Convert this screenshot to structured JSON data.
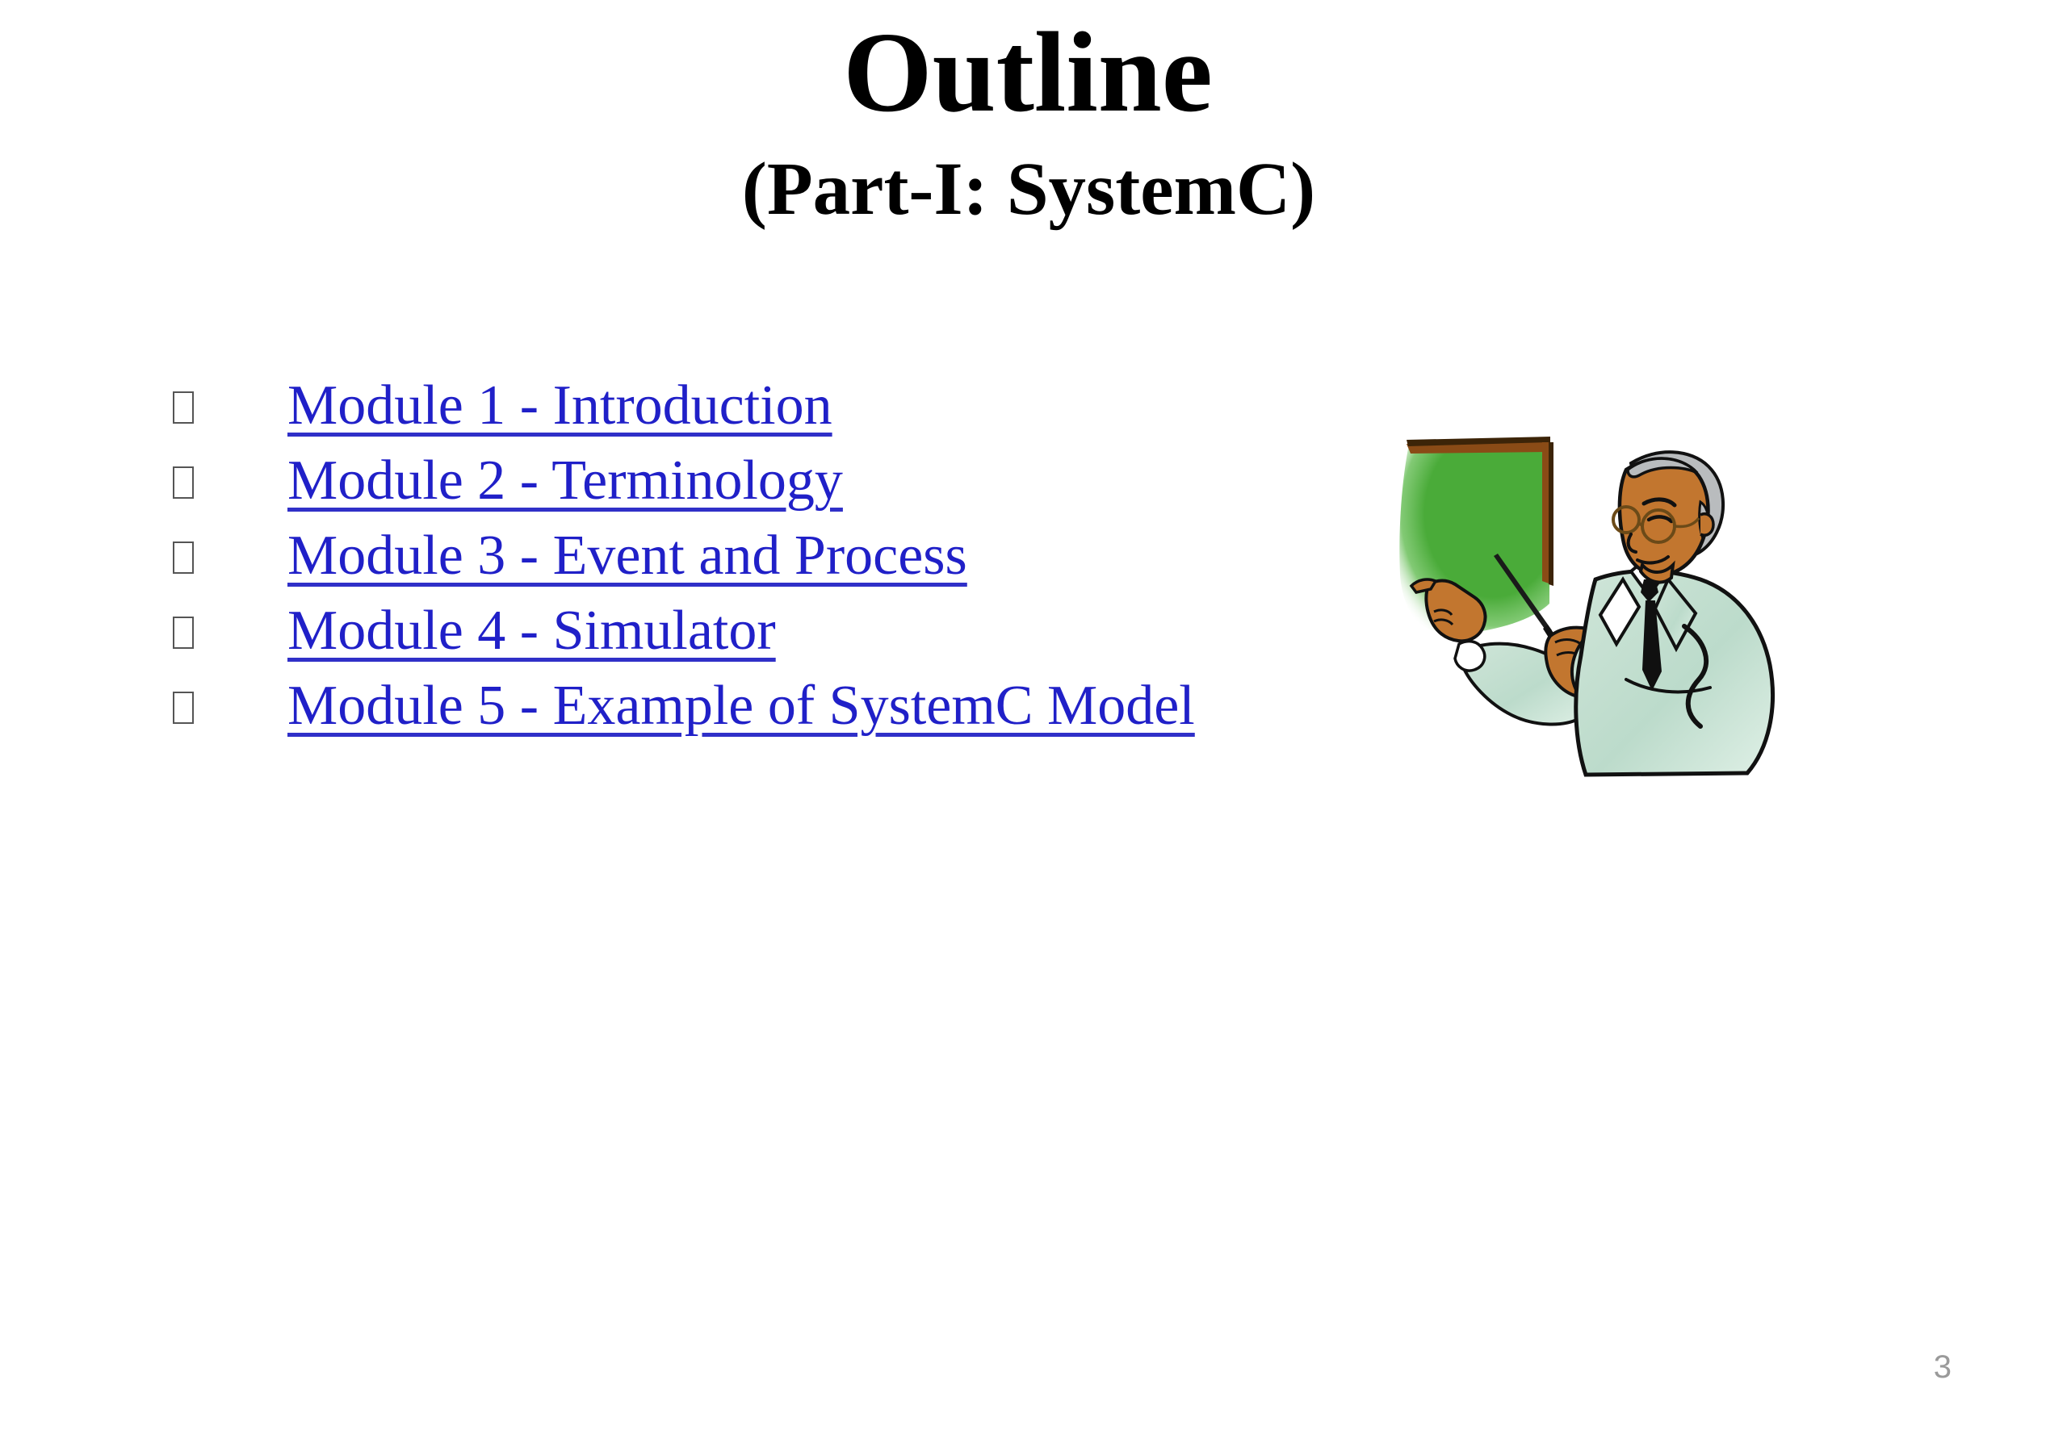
{
  "slide": {
    "background_color": "#ffffff",
    "title": "Outline",
    "subtitle": "(Part-I: SystemC)",
    "page_number": "3"
  },
  "outline": {
    "bullet_glyph": "missing-glyph-box",
    "link_color": "#2020c8",
    "items": [
      {
        "label": "Module 1 - Introduction"
      },
      {
        "label": "Module 2 - Terminology"
      },
      {
        "label": "Module 3 - Event and Process"
      },
      {
        "label": "Module 4 - Simulator"
      },
      {
        "label": "Module 5 - Example of SystemC Model"
      }
    ]
  },
  "clipart": {
    "name": "presenter-at-chalkboard",
    "description": "Man in light green suit with glasses pointing a stick at a green chalkboard",
    "colors": {
      "board_green": "#4aab39",
      "board_frame_brown": "#8a4b16",
      "suit_green": "#bcdbcb",
      "skin_brown": "#c2762f",
      "hair_gray": "#b9bcbe",
      "outline_black": "#111111",
      "shirt_white": "#ffffff",
      "tie_black": "#101010"
    }
  }
}
